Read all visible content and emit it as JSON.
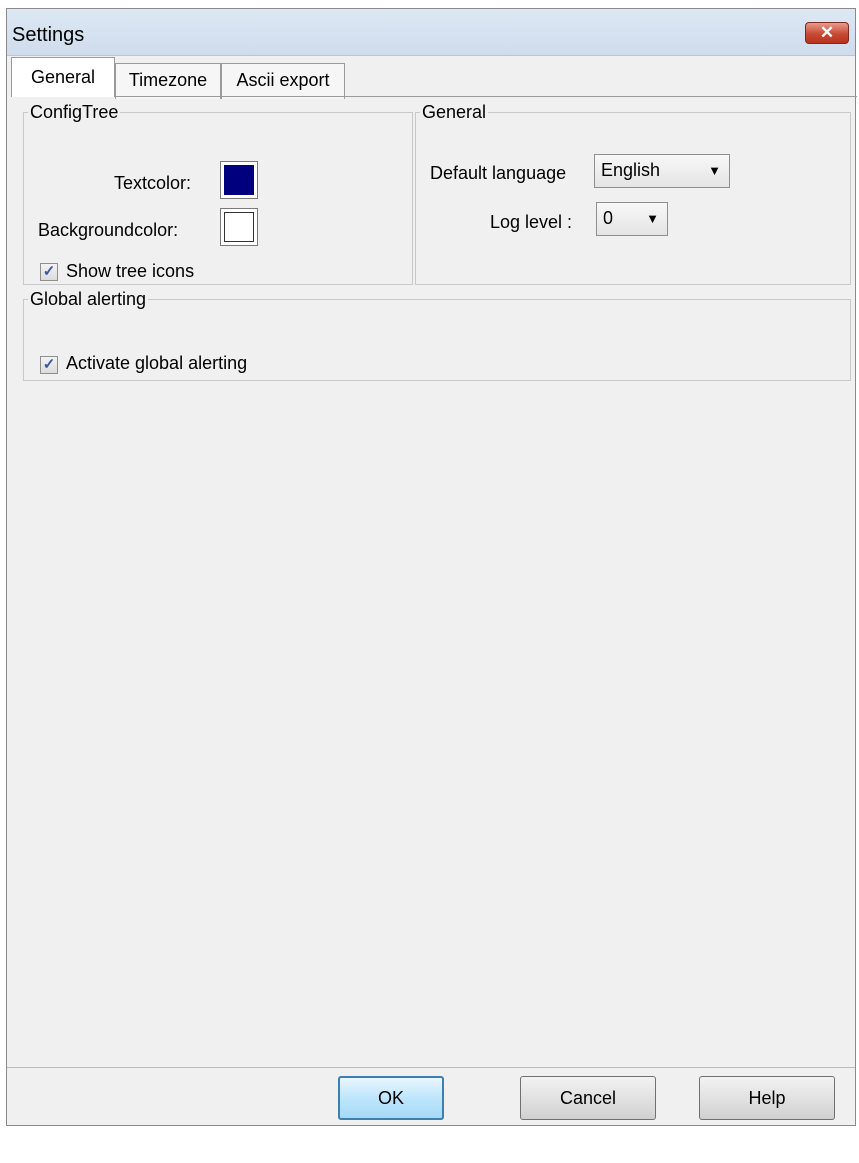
{
  "window": {
    "title": "Settings",
    "close_glyph": "✕"
  },
  "tabs": [
    {
      "label": "General",
      "active": true
    },
    {
      "label": "Timezone",
      "active": false
    },
    {
      "label": "Ascii export",
      "active": false
    }
  ],
  "config_tree": {
    "legend": "ConfigTree",
    "textcolor_label": "Textcolor:",
    "textcolor_value": "#00007f",
    "backgroundcolor_label": "Backgroundcolor:",
    "backgroundcolor_value": "#ffffff",
    "show_tree_icons_label": "Show tree icons",
    "show_tree_icons_checked": true
  },
  "general": {
    "legend": "General",
    "default_language_label": "Default language",
    "default_language_value": "English",
    "log_level_label": "Log level :",
    "log_level_value": "0"
  },
  "global_alerting": {
    "legend": "Global alerting",
    "activate_label": "Activate global alerting",
    "activate_checked": true
  },
  "buttons": {
    "ok": "OK",
    "cancel": "Cancel",
    "help": "Help"
  },
  "icons": {
    "check": "✓",
    "dropdown": "▼"
  }
}
